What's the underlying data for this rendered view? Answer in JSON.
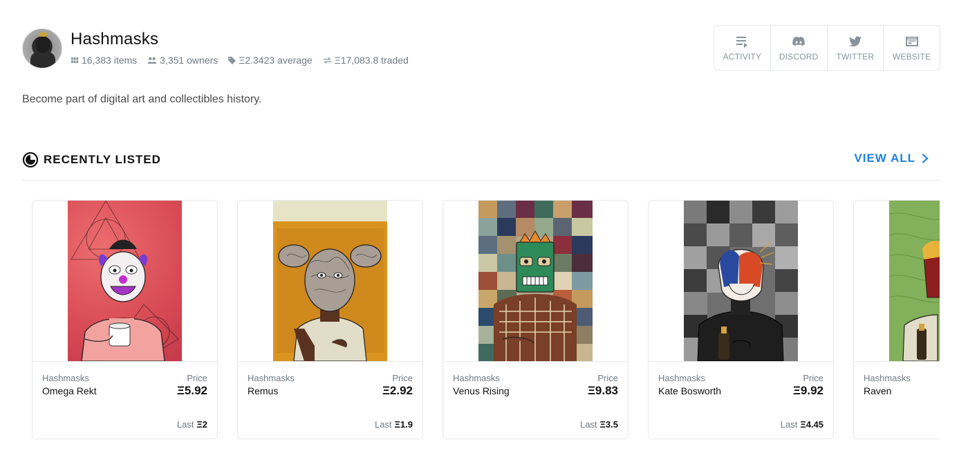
{
  "collection": {
    "title": "Hashmasks",
    "stats": {
      "items": "16,383 items",
      "owners": "3,351 owners",
      "average": "Ξ2.3423 average",
      "traded": "Ξ17,083.8 traded"
    },
    "description": "Become part of digital art and collectibles history."
  },
  "social": [
    {
      "label": "ACTIVITY",
      "icon": "activity-icon"
    },
    {
      "label": "DISCORD",
      "icon": "discord-icon"
    },
    {
      "label": "TWITTER",
      "icon": "twitter-icon"
    },
    {
      "label": "WEBSITE",
      "icon": "website-icon"
    }
  ],
  "section": {
    "title": "RECENTLY LISTED",
    "view_all": "VIEW ALL"
  },
  "cards": [
    {
      "collection": "Hashmasks",
      "name": "Omega Rekt",
      "price_label": "Price",
      "price": "Ξ5.92",
      "last_label": "Last",
      "last": "Ξ2"
    },
    {
      "collection": "Hashmasks",
      "name": "Remus",
      "price_label": "Price",
      "price": "Ξ2.92",
      "last_label": "Last",
      "last": "Ξ1.9"
    },
    {
      "collection": "Hashmasks",
      "name": "Venus Rising",
      "price_label": "Price",
      "price": "Ξ9.83",
      "last_label": "Last",
      "last": "Ξ3.5"
    },
    {
      "collection": "Hashmasks",
      "name": "Kate Bosworth",
      "price_label": "Price",
      "price": "Ξ9.92",
      "last_label": "Last",
      "last": "Ξ4.45"
    },
    {
      "collection": "Hashmasks",
      "name": "Raven"
    }
  ],
  "colors": {
    "accent": "#2081e2",
    "muted_text": "#707a83",
    "border": "#e5e8eb"
  }
}
